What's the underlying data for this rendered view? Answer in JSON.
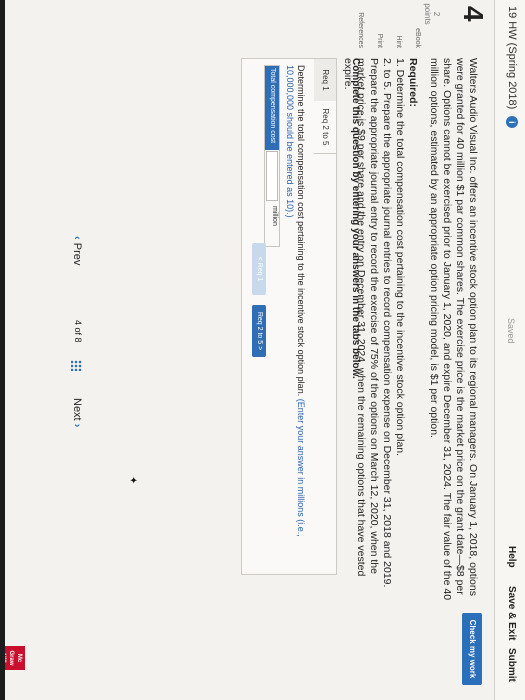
{
  "header": {
    "tab_text": "19 HW (Spring 2018)",
    "info": "i",
    "saved": "Saved",
    "help": "Help",
    "save_exit": "Save & Exit",
    "submit": "Submit",
    "check_work": "Check my work"
  },
  "question": {
    "number": "4",
    "points": "2\npoints",
    "side_links": [
      "eBook",
      "Hint",
      "Print",
      "References"
    ],
    "body": "Walters Audio Visual Inc. offers an incentive stock option plan to its regional managers. On January 1, 2018, options were granted for 40 million $1 par common shares. The exercise price is the market price on the grant date—$8 per share. Options cannot be exercised prior to January 1, 2020, and expire December 31, 2024. The fair value of the 40 million options, estimated by an appropriate option pricing model, is $1 per option.",
    "required_heading": "Required:",
    "req1": "1. Determine the total compensation cost pertaining to the incentive stock option plan.",
    "req2": "2. to 5. Prepare the appropriate journal entries to record compensation expense on December 31, 2018 and 2019. Prepare the appropriate journal entry to record the exercise of 75% of the options on March 12, 2020, when the market price is $9 per share and the entry on December 31, 2024, when the remaining options that have vested expire.",
    "complete_prompt": "Complete this question by entering your answers in the tabs below."
  },
  "tabs": {
    "tab1": "Req 1",
    "tab2": "Req 2 to 5",
    "instruction": "Determine the total compensation cost pertaining to the incentive stock option plan.",
    "instruction_note": "(Enter your answer in millions (i.e., 10,000,000 should be entered as 10).)",
    "row_label": "Total compensation cost",
    "row_value": "",
    "row_unit": "million",
    "prev_button": "< Req 1",
    "next_button": "Req 2 to 5  >"
  },
  "pager": {
    "prev": "Prev",
    "page_info": "4 of 8",
    "next": "Next"
  },
  "logo": "Mc\nGraw\nHill",
  "colors": {
    "accent": "#2b6fba",
    "logo_red": "#c8102e"
  }
}
